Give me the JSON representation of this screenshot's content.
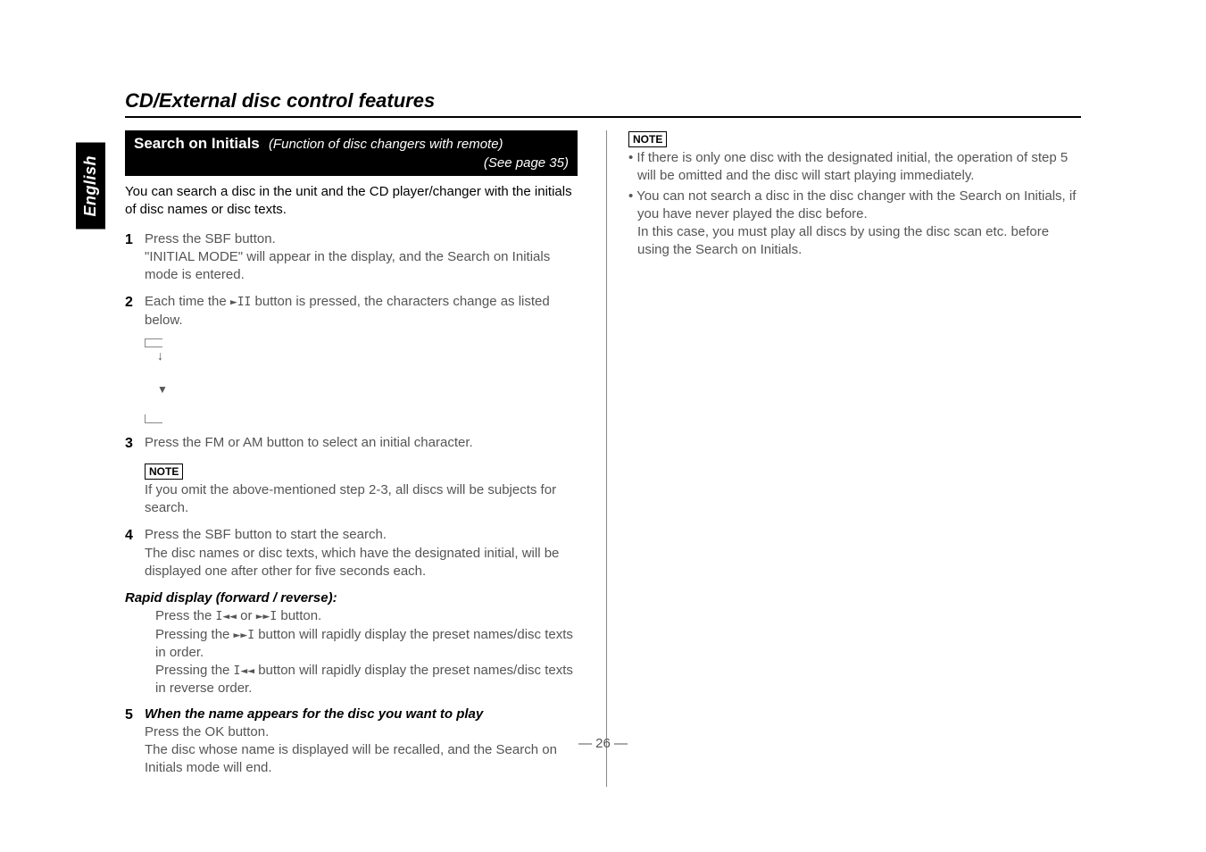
{
  "lang": "English",
  "title": "CD/External disc control features",
  "banner": {
    "title": "Search on Initials",
    "sub": "(Function of disc changers with remote)",
    "sub2": "(See page 35)"
  },
  "intro": "You can search a disc in the unit and the CD player/changer with the initials of disc names or disc texts.",
  "steps": {
    "s1a": "Press the SBF button.",
    "s1b": "\"INITIAL MODE\" will appear in the display, and the Search on Initials mode is entered.",
    "s2a": "Each time the ",
    "s2b": " button is pressed, the characters change as listed below.",
    "s3": "Press the FM or AM button to select an initial character.",
    "s4a": "Press the SBF button to start the search.",
    "s4b": "The disc names or disc texts, which have the designated initial, will be displayed one after other for five seconds each.",
    "s5title": "When the name appears for the disc you want to play",
    "s5a": "Press the OK button.",
    "s5b": "The disc whose name is displayed will be recalled, and the Search on Initials mode will end."
  },
  "note_label": "NOTE",
  "inline_note": "If you omit the above-mentioned step 2-3, all discs will be subjects for search.",
  "rapid": {
    "title": "Rapid display (forward / reverse):",
    "l1a": "Press the ",
    "l1b": " or ",
    "l1c": " button.",
    "l2a": "Pressing the ",
    "l2b": " button will rapidly display the preset names/disc texts in order.",
    "l3a": "Pressing the ",
    "l3b": " button will rapidly display the preset names/disc texts in reverse order."
  },
  "icons": {
    "playpause": "►II",
    "prev": "I◄◄",
    "next": "►►I"
  },
  "right_notes": {
    "n1": "If there is only one disc with the designated initial, the operation of step 5 will be omitted and the disc will start playing immediately.",
    "n2": "You can not search a disc in the disc changer with the Search on Initials, if you have never played the disc before.",
    "n2b": "In this case, you must play all discs by using the disc scan etc. before using the Search on Initials."
  },
  "page_number": "— 26 —"
}
